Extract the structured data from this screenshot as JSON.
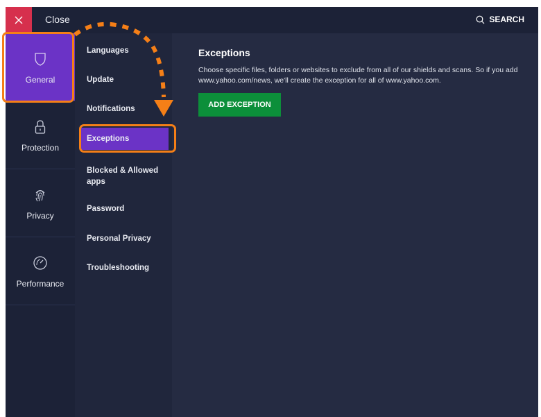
{
  "titlebar": {
    "close_label": "Close",
    "search_label": "SEARCH"
  },
  "sidebar": {
    "items": [
      {
        "label": "General",
        "icon": "shield-icon",
        "active": true
      },
      {
        "label": "Protection",
        "icon": "lock-icon",
        "active": false
      },
      {
        "label": "Privacy",
        "icon": "fingerprint-icon",
        "active": false
      },
      {
        "label": "Performance",
        "icon": "gauge-icon",
        "active": false
      }
    ]
  },
  "subnav": {
    "items": [
      {
        "label": "Languages"
      },
      {
        "label": "Update"
      },
      {
        "label": "Notifications"
      },
      {
        "label": "Exceptions",
        "active": true
      },
      {
        "label": "Blocked & Allowed apps"
      },
      {
        "label": "Password"
      },
      {
        "label": "Personal Privacy"
      },
      {
        "label": "Troubleshooting"
      }
    ]
  },
  "main": {
    "title": "Exceptions",
    "description": "Choose specific files, folders or websites to exclude from all of our shields and scans. So if you add www.yahoo.com/news, we'll create the exception for all of www.yahoo.com.",
    "button_label": "ADD EXCEPTION"
  },
  "colors": {
    "accent": "#6b33c6",
    "highlight": "#f57f17",
    "button": "#0c8f3a",
    "close": "#d6304d"
  }
}
